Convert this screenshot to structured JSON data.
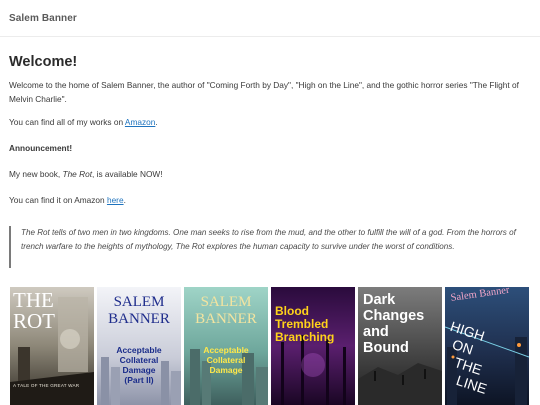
{
  "header": {
    "site_title": "Salem Banner"
  },
  "main": {
    "heading": "Welcome!",
    "intro": "Welcome to the home of Salem Banner, the author of \"Coming Forth by Day\", \"High on the Line\", and the gothic horror series \"The Flight of Melvin Charlie\".",
    "works_prefix": "You can find all of my works on ",
    "works_link": "Amazon",
    "works_suffix": ".",
    "announcement": "Announcement!",
    "newbook_prefix": "My new book, ",
    "newbook_title": "The Rot",
    "newbook_suffix": ", is available NOW!",
    "findit_prefix": "You can find it on Amazon ",
    "findit_link": "here",
    "findit_suffix": ".",
    "quote_title": "The Rot",
    "quote_rest": " tells of two men in two kingdoms. One man seeks to rise from the mud, and the other to fulfill the will of a god. From the horrors of trench warfare to the heights of mythology, ",
    "quote_title2": "The Rot",
    "quote_end": " explores the human capacity to survive under the worst of conditions."
  },
  "books": [
    {
      "title_line1": "THE",
      "title_line2": "ROT",
      "subtitle": "A TALE OF THE GREAT WAR"
    },
    {
      "author_line1": "SALEM",
      "author_line2": "BANNER",
      "title_line1": "Acceptable",
      "title_line2": "Collateral",
      "title_line3": "Damage",
      "title_line4": "(Part II)"
    },
    {
      "author_line1": "SALEM",
      "author_line2": "BANNER",
      "title_line1": "Acceptable",
      "title_line2": "Collateral",
      "title_line3": "Damage"
    },
    {
      "title_line1": "Blood",
      "title_line2": "Trembled",
      "title_line3": "Branching"
    },
    {
      "title_line1": "Dark",
      "title_line2": "Changes",
      "title_line3": "and",
      "title_line4": "Bound"
    },
    {
      "author": "Salem Banner",
      "title_line1": "HIGH",
      "title_line2": "ON",
      "title_line3": "THE",
      "title_line4": "LINE"
    }
  ],
  "colors": {
    "link": "#1e73be",
    "book2_title": "#1a2c8a",
    "book3_title": "#ffe84a",
    "book4_title": "#ffd21a"
  }
}
